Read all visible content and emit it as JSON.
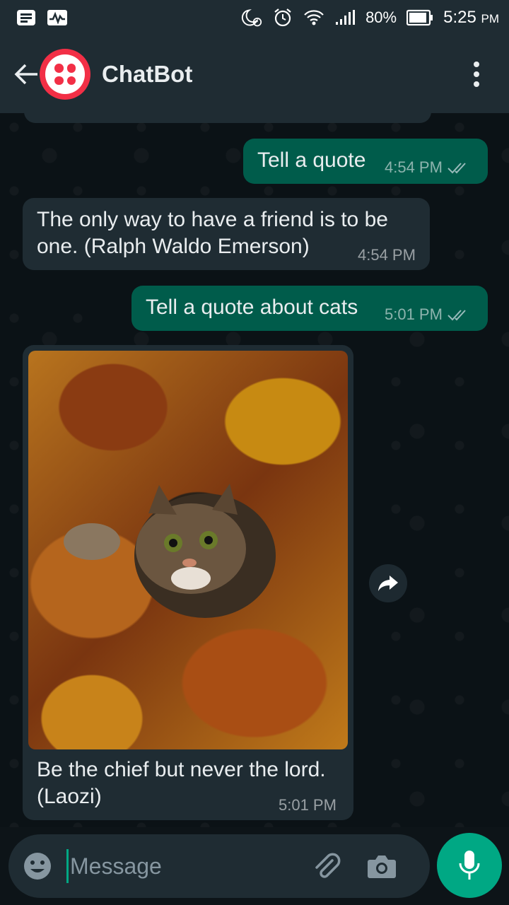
{
  "status_bar": {
    "battery_percent": "80%",
    "time": "5:25",
    "time_suffix": "PM"
  },
  "header": {
    "title": "ChatBot",
    "avatar_color": "#f22f46"
  },
  "messages": [
    {
      "direction": "out",
      "text": "Tell a quote",
      "time": "4:54 PM",
      "read": true
    },
    {
      "direction": "in",
      "text": "The only way to have a friend is to be one. (Ralph Waldo Emerson)",
      "time": "4:54 PM"
    },
    {
      "direction": "out",
      "text": "Tell a quote about cats",
      "time": "5:01 PM",
      "read": true
    },
    {
      "direction": "in",
      "media": "cat-in-autumn-leaves-photo",
      "caption": "Be the chief but never the lord. (Laozi)",
      "time": "5:01 PM"
    }
  ],
  "composer": {
    "placeholder": "Message"
  },
  "colors": {
    "accent": "#00a884",
    "incoming_bubble": "#1f2c33",
    "outgoing_bubble": "#005c4b",
    "background": "#0b1216"
  },
  "icons": {
    "status_left": [
      "notes-icon",
      "activity-icon"
    ],
    "status_right": [
      "night-alarm-icon",
      "alarm-icon",
      "wifi-icon",
      "signal-icon",
      "battery-icon"
    ],
    "header": [
      "back-arrow-icon",
      "more-vert-icon"
    ],
    "composer": [
      "emoji-icon",
      "attach-icon",
      "camera-icon",
      "mic-icon"
    ],
    "message": [
      "read-receipt-icon",
      "forward-icon"
    ]
  }
}
